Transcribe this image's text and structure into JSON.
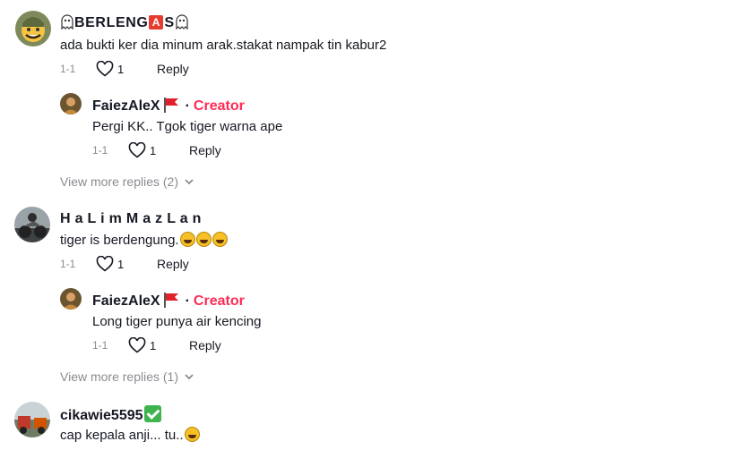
{
  "comments": [
    {
      "username": "BERLENG",
      "username_tail": "S",
      "badge_letter": "A",
      "text": "ada bukti ker dia minum arak.stakat nampak tin kabur2",
      "date": "1-1",
      "likes": "1",
      "reply_label": "Reply",
      "icons": [
        "ghost-emoji",
        "letter-a-emoji",
        "ghost-emoji"
      ],
      "replies": [
        {
          "username": "FaiezAleX",
          "flag_icon": "red-flag-emoji",
          "role": "Creator",
          "text": "Pergi KK.. Tgok tiger warna ape",
          "date": "1-1",
          "likes": "1",
          "reply_label": "Reply"
        }
      ],
      "view_more": "View more replies (2)"
    },
    {
      "username": "H a L i m M a z L a n",
      "text": "tiger is berdengung.",
      "text_emojis": [
        "grinning-sweat-emoji",
        "grinning-sweat-emoji",
        "grinning-sweat-emoji"
      ],
      "date": "1-1",
      "likes": "1",
      "reply_label": "Reply",
      "replies": [
        {
          "username": "FaiezAleX",
          "flag_icon": "red-flag-emoji",
          "role": "Creator",
          "text": "Long tiger punya air kencing",
          "date": "1-1",
          "likes": "1",
          "reply_label": "Reply"
        }
      ],
      "view_more": "View more replies (1)"
    },
    {
      "username": "cikawie5595",
      "username_icon": "check-mark-emoji",
      "text": "cap kepala anji... tu..",
      "text_emojis": [
        "grinning-sweat-emoji"
      ]
    }
  ],
  "colors": {
    "text": "#161823",
    "muted": "#8a8b91",
    "creator": "#fe2c55"
  },
  "reply_separator": "·"
}
